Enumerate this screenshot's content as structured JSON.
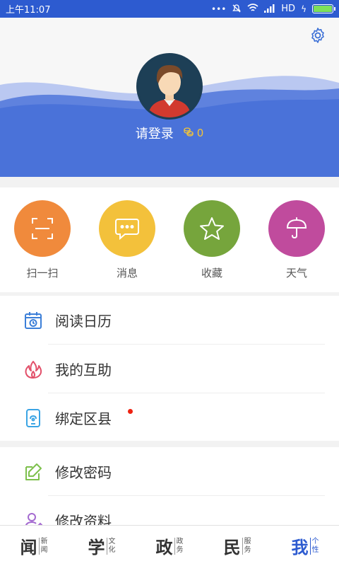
{
  "status_bar": {
    "time": "上午11:07",
    "network": "HD"
  },
  "profile": {
    "login_label": "请登录",
    "coins": "0"
  },
  "quick_actions": [
    {
      "id": "scan",
      "label": "扫一扫",
      "color": "#f08a3c",
      "icon": "scan-icon"
    },
    {
      "id": "messages",
      "label": "消息",
      "color": "#f3c13b",
      "icon": "message-icon"
    },
    {
      "id": "favorites",
      "label": "收藏",
      "color": "#76a53c",
      "icon": "star-icon"
    },
    {
      "id": "weather",
      "label": "天气",
      "color": "#c04b9d",
      "icon": "umbrella-icon"
    }
  ],
  "menu_group_1": [
    {
      "label": "阅读日历",
      "icon": "calendar-icon",
      "icon_color": "#3c7fd8"
    },
    {
      "label": "我的互助",
      "icon": "flame-icon",
      "icon_color": "#e2506a"
    },
    {
      "label": "绑定区县",
      "icon": "phone-link-icon",
      "icon_color": "#3aa4e4",
      "notification_dot": true
    }
  ],
  "menu_group_2": [
    {
      "label": "修改密码",
      "icon": "edit-icon",
      "icon_color": "#7dc04c"
    },
    {
      "label": "修改资料",
      "icon": "user-edit-icon",
      "icon_color": "#a46ad0"
    }
  ],
  "tab_bar": [
    {
      "main": "闻",
      "sub1": "新",
      "sub2": "闻",
      "active": false
    },
    {
      "main": "学",
      "sub1": "文",
      "sub2": "化",
      "active": false
    },
    {
      "main": "政",
      "sub1": "政",
      "sub2": "务",
      "active": false
    },
    {
      "main": "民",
      "sub1": "服",
      "sub2": "务",
      "active": false
    },
    {
      "main": "我",
      "sub1": "个",
      "sub2": "性",
      "active": true
    }
  ],
  "colors": {
    "brand_blue": "#2d5bd0",
    "coin_yellow": "#f3c437"
  }
}
